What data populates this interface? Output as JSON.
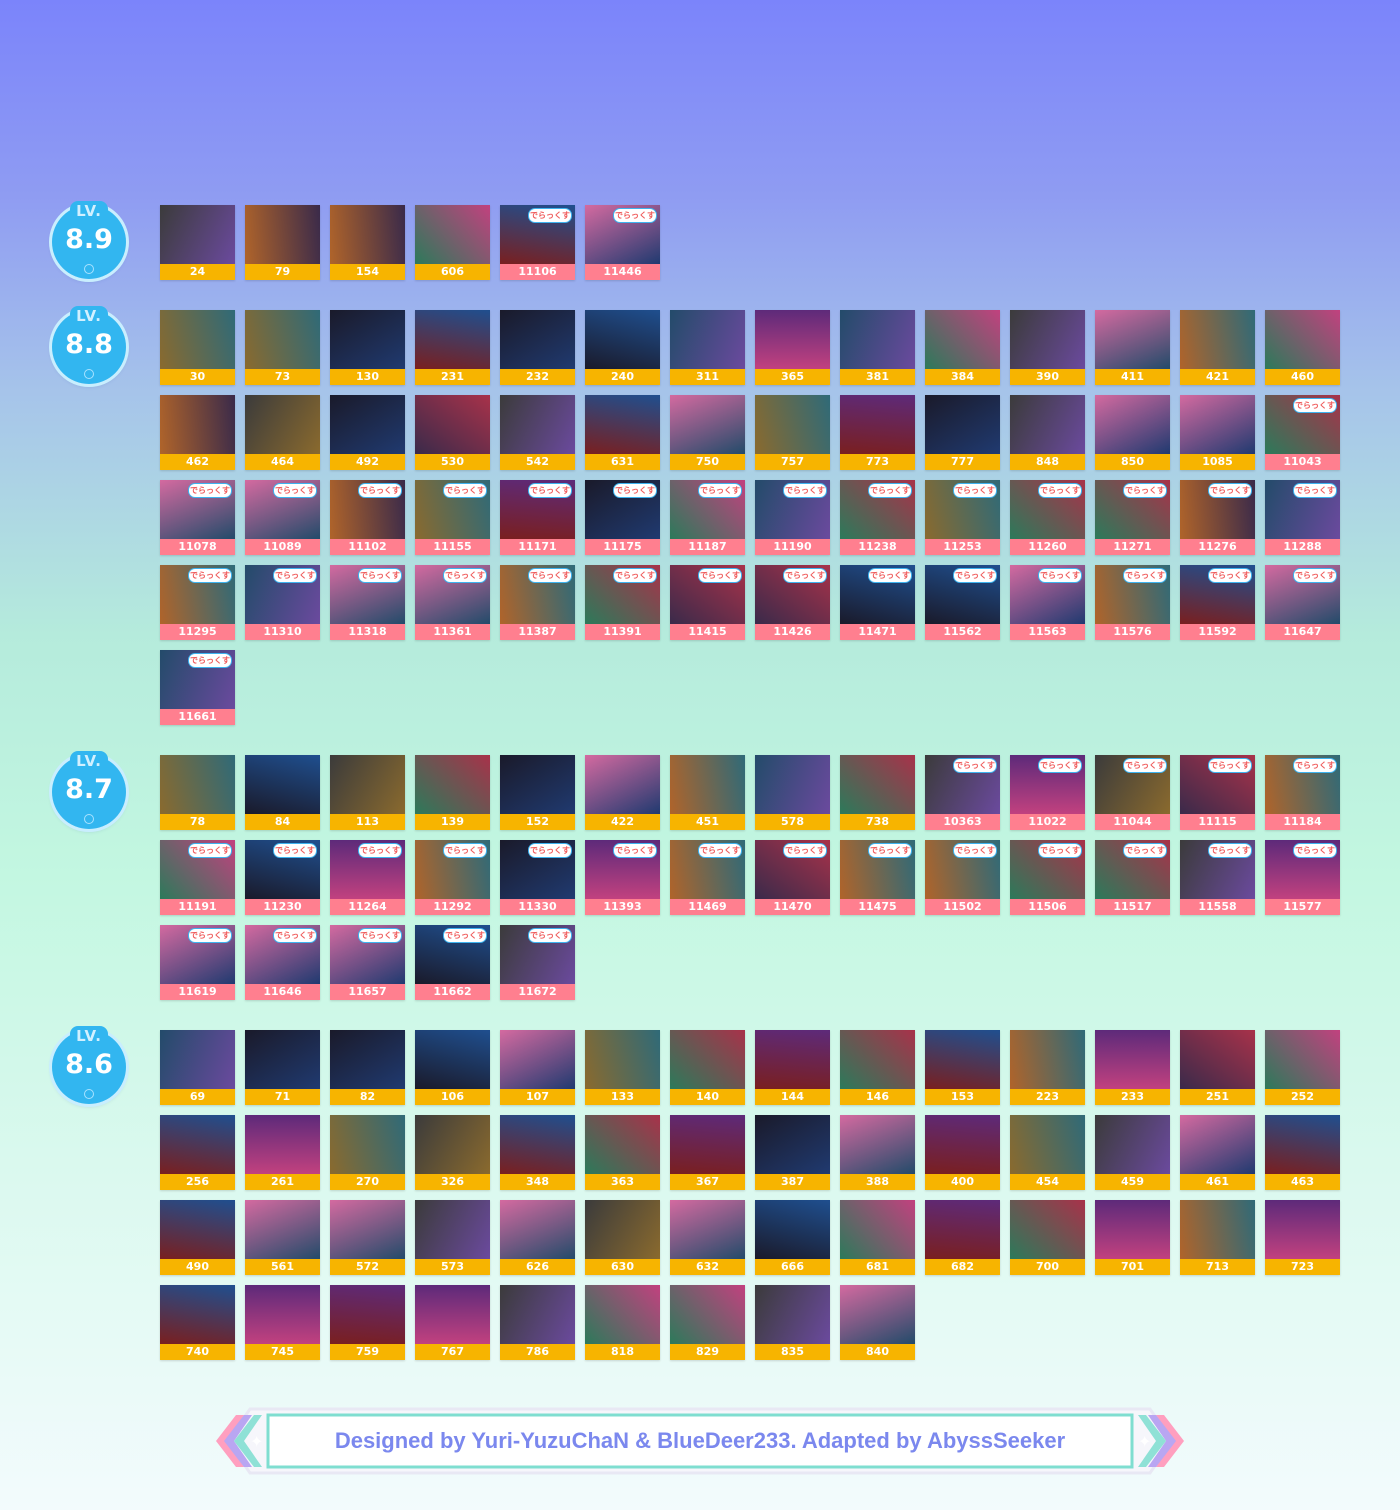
{
  "colors": {
    "badge": "#32b6f0",
    "id_std": "#f7b400",
    "id_dx": "#ff7f8f",
    "footer_text": "#7b88ee",
    "dx_logo_text": "#ef5a5a"
  },
  "badge_tag": "LV.",
  "dx_label": "でらっくす",
  "levels": [
    {
      "level": "8.9",
      "songs": [
        {
          "id": "24",
          "dx": false
        },
        {
          "id": "79",
          "dx": false
        },
        {
          "id": "154",
          "dx": false
        },
        {
          "id": "606",
          "dx": false
        },
        {
          "id": "11106",
          "dx": true
        },
        {
          "id": "11446",
          "dx": true
        }
      ]
    },
    {
      "level": "8.8",
      "songs": [
        {
          "id": "30",
          "dx": false
        },
        {
          "id": "73",
          "dx": false
        },
        {
          "id": "130",
          "dx": false
        },
        {
          "id": "231",
          "dx": false
        },
        {
          "id": "232",
          "dx": false
        },
        {
          "id": "240",
          "dx": false
        },
        {
          "id": "311",
          "dx": false
        },
        {
          "id": "365",
          "dx": false
        },
        {
          "id": "381",
          "dx": false
        },
        {
          "id": "384",
          "dx": false
        },
        {
          "id": "390",
          "dx": false
        },
        {
          "id": "411",
          "dx": false
        },
        {
          "id": "421",
          "dx": false
        },
        {
          "id": "460",
          "dx": false
        },
        {
          "id": "462",
          "dx": false
        },
        {
          "id": "464",
          "dx": false
        },
        {
          "id": "492",
          "dx": false
        },
        {
          "id": "530",
          "dx": false
        },
        {
          "id": "542",
          "dx": false
        },
        {
          "id": "631",
          "dx": false
        },
        {
          "id": "750",
          "dx": false
        },
        {
          "id": "757",
          "dx": false
        },
        {
          "id": "773",
          "dx": false
        },
        {
          "id": "777",
          "dx": false
        },
        {
          "id": "848",
          "dx": false
        },
        {
          "id": "850",
          "dx": false
        },
        {
          "id": "1085",
          "dx": false
        },
        {
          "id": "11043",
          "dx": true
        },
        {
          "id": "11078",
          "dx": true
        },
        {
          "id": "11089",
          "dx": true
        },
        {
          "id": "11102",
          "dx": true
        },
        {
          "id": "11155",
          "dx": true
        },
        {
          "id": "11171",
          "dx": true
        },
        {
          "id": "11175",
          "dx": true
        },
        {
          "id": "11187",
          "dx": true
        },
        {
          "id": "11190",
          "dx": true
        },
        {
          "id": "11238",
          "dx": true
        },
        {
          "id": "11253",
          "dx": true
        },
        {
          "id": "11260",
          "dx": true
        },
        {
          "id": "11271",
          "dx": true
        },
        {
          "id": "11276",
          "dx": true
        },
        {
          "id": "11288",
          "dx": true
        },
        {
          "id": "11295",
          "dx": true
        },
        {
          "id": "11310",
          "dx": true
        },
        {
          "id": "11318",
          "dx": true
        },
        {
          "id": "11361",
          "dx": true
        },
        {
          "id": "11387",
          "dx": true
        },
        {
          "id": "11391",
          "dx": true
        },
        {
          "id": "11415",
          "dx": true
        },
        {
          "id": "11426",
          "dx": true
        },
        {
          "id": "11471",
          "dx": true
        },
        {
          "id": "11562",
          "dx": true
        },
        {
          "id": "11563",
          "dx": true
        },
        {
          "id": "11576",
          "dx": true
        },
        {
          "id": "11592",
          "dx": true
        },
        {
          "id": "11647",
          "dx": true
        },
        {
          "id": "11661",
          "dx": true
        }
      ]
    },
    {
      "level": "8.7",
      "songs": [
        {
          "id": "78",
          "dx": false
        },
        {
          "id": "84",
          "dx": false
        },
        {
          "id": "113",
          "dx": false
        },
        {
          "id": "139",
          "dx": false
        },
        {
          "id": "152",
          "dx": false
        },
        {
          "id": "422",
          "dx": false
        },
        {
          "id": "451",
          "dx": false
        },
        {
          "id": "578",
          "dx": false
        },
        {
          "id": "738",
          "dx": false
        },
        {
          "id": "10363",
          "dx": true
        },
        {
          "id": "11022",
          "dx": true
        },
        {
          "id": "11044",
          "dx": true
        },
        {
          "id": "11115",
          "dx": true
        },
        {
          "id": "11184",
          "dx": true
        },
        {
          "id": "11191",
          "dx": true
        },
        {
          "id": "11230",
          "dx": true
        },
        {
          "id": "11264",
          "dx": true
        },
        {
          "id": "11292",
          "dx": true
        },
        {
          "id": "11330",
          "dx": true
        },
        {
          "id": "11393",
          "dx": true
        },
        {
          "id": "11469",
          "dx": true
        },
        {
          "id": "11470",
          "dx": true
        },
        {
          "id": "11475",
          "dx": true
        },
        {
          "id": "11502",
          "dx": true
        },
        {
          "id": "11506",
          "dx": true
        },
        {
          "id": "11517",
          "dx": true
        },
        {
          "id": "11558",
          "dx": true
        },
        {
          "id": "11577",
          "dx": true
        },
        {
          "id": "11619",
          "dx": true
        },
        {
          "id": "11646",
          "dx": true
        },
        {
          "id": "11657",
          "dx": true
        },
        {
          "id": "11662",
          "dx": true
        },
        {
          "id": "11672",
          "dx": true
        }
      ]
    },
    {
      "level": "8.6",
      "songs": [
        {
          "id": "69",
          "dx": false
        },
        {
          "id": "71",
          "dx": false
        },
        {
          "id": "82",
          "dx": false
        },
        {
          "id": "106",
          "dx": false
        },
        {
          "id": "107",
          "dx": false
        },
        {
          "id": "133",
          "dx": false
        },
        {
          "id": "140",
          "dx": false
        },
        {
          "id": "144",
          "dx": false
        },
        {
          "id": "146",
          "dx": false
        },
        {
          "id": "153",
          "dx": false
        },
        {
          "id": "223",
          "dx": false
        },
        {
          "id": "233",
          "dx": false
        },
        {
          "id": "251",
          "dx": false
        },
        {
          "id": "252",
          "dx": false
        },
        {
          "id": "256",
          "dx": false
        },
        {
          "id": "261",
          "dx": false
        },
        {
          "id": "270",
          "dx": false
        },
        {
          "id": "326",
          "dx": false
        },
        {
          "id": "348",
          "dx": false
        },
        {
          "id": "363",
          "dx": false
        },
        {
          "id": "367",
          "dx": false
        },
        {
          "id": "387",
          "dx": false
        },
        {
          "id": "388",
          "dx": false
        },
        {
          "id": "400",
          "dx": false
        },
        {
          "id": "454",
          "dx": false
        },
        {
          "id": "459",
          "dx": false
        },
        {
          "id": "461",
          "dx": false
        },
        {
          "id": "463",
          "dx": false
        },
        {
          "id": "490",
          "dx": false
        },
        {
          "id": "561",
          "dx": false
        },
        {
          "id": "572",
          "dx": false
        },
        {
          "id": "573",
          "dx": false
        },
        {
          "id": "626",
          "dx": false
        },
        {
          "id": "630",
          "dx": false
        },
        {
          "id": "632",
          "dx": false
        },
        {
          "id": "666",
          "dx": false
        },
        {
          "id": "681",
          "dx": false
        },
        {
          "id": "682",
          "dx": false
        },
        {
          "id": "700",
          "dx": false
        },
        {
          "id": "701",
          "dx": false
        },
        {
          "id": "713",
          "dx": false
        },
        {
          "id": "723",
          "dx": false
        },
        {
          "id": "740",
          "dx": false
        },
        {
          "id": "745",
          "dx": false
        },
        {
          "id": "759",
          "dx": false
        },
        {
          "id": "767",
          "dx": false
        },
        {
          "id": "786",
          "dx": false
        },
        {
          "id": "818",
          "dx": false
        },
        {
          "id": "829",
          "dx": false
        },
        {
          "id": "835",
          "dx": false
        },
        {
          "id": "840",
          "dx": false
        }
      ]
    }
  ],
  "footer": {
    "text": "Designed by Yuri-YuzuChaN & BlueDeer233. Adapted by AbyssSeeker"
  }
}
